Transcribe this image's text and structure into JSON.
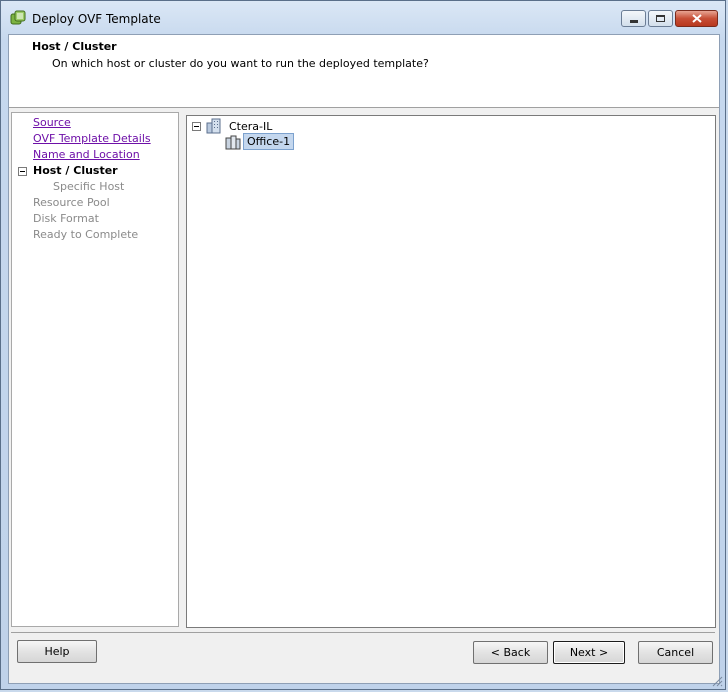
{
  "window": {
    "title": "Deploy OVF Template",
    "icon": "vsphere-deploy-icon"
  },
  "header": {
    "title": "Host / Cluster",
    "subtitle": "On which host or cluster do you want to run the deployed template?"
  },
  "nav": {
    "items": [
      {
        "label": "Source",
        "state": "link"
      },
      {
        "label": "OVF Template Details",
        "state": "link"
      },
      {
        "label": "Name and Location",
        "state": "link"
      },
      {
        "label": "Host / Cluster",
        "state": "current"
      },
      {
        "label": "Specific Host",
        "state": "disabled"
      },
      {
        "label": "Resource Pool",
        "state": "disabled"
      },
      {
        "label": "Disk Format",
        "state": "disabled"
      },
      {
        "label": "Ready to Complete",
        "state": "disabled"
      }
    ]
  },
  "tree": {
    "datacenter": {
      "label": "Ctera-IL",
      "icon": "datacenter-icon",
      "expanded": true
    },
    "cluster": {
      "label": "Office-1",
      "icon": "cluster-icon",
      "selected": true
    }
  },
  "buttons": {
    "help": "Help",
    "back": "< Back",
    "next": "Next >",
    "cancel": "Cancel"
  }
}
